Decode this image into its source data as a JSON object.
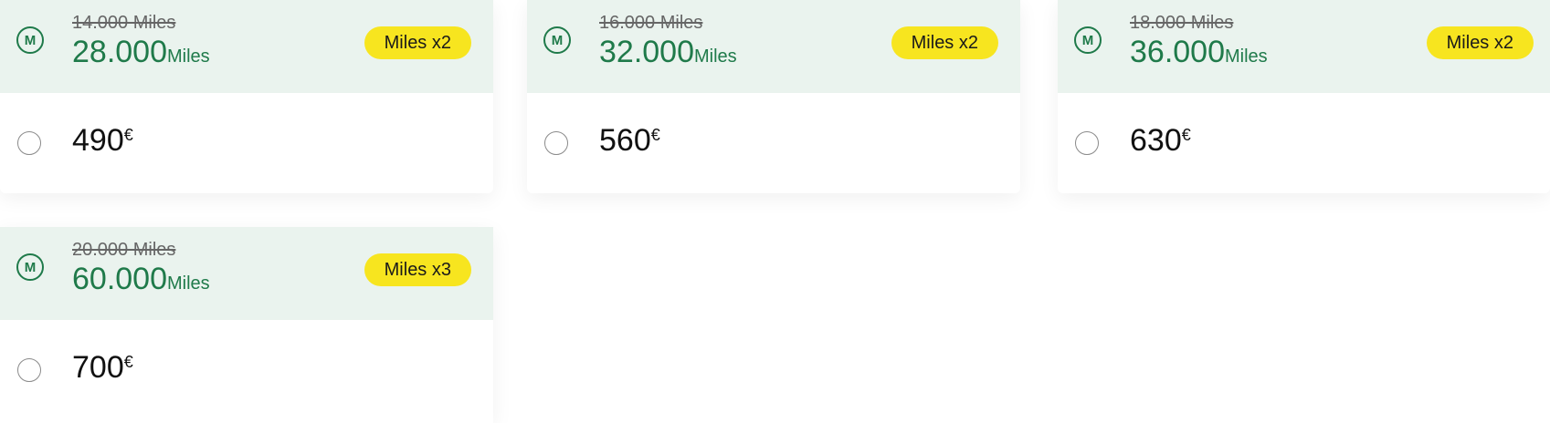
{
  "offers": [
    {
      "old_miles": "14.000 Miles",
      "new_miles_value": "28.000",
      "new_miles_unit": "Miles",
      "badge": "Miles x2",
      "price": "490",
      "currency": "€"
    },
    {
      "old_miles": "16.000 Miles",
      "new_miles_value": "32.000",
      "new_miles_unit": "Miles",
      "badge": "Miles x2",
      "price": "560",
      "currency": "€"
    },
    {
      "old_miles": "18.000 Miles",
      "new_miles_value": "36.000",
      "new_miles_unit": "Miles",
      "badge": "Miles x2",
      "price": "630",
      "currency": "€"
    },
    {
      "old_miles": "20.000 Miles",
      "new_miles_value": "60.000",
      "new_miles_unit": "Miles",
      "badge": "Miles x3",
      "price": "700",
      "currency": "€"
    }
  ],
  "miles_icon_letter": "M",
  "icon": "miles-coin-icon",
  "colors": {
    "accent_green": "#1f7a4a",
    "header_bg": "#eaf3ee",
    "badge_yellow": "#f7e51f"
  }
}
